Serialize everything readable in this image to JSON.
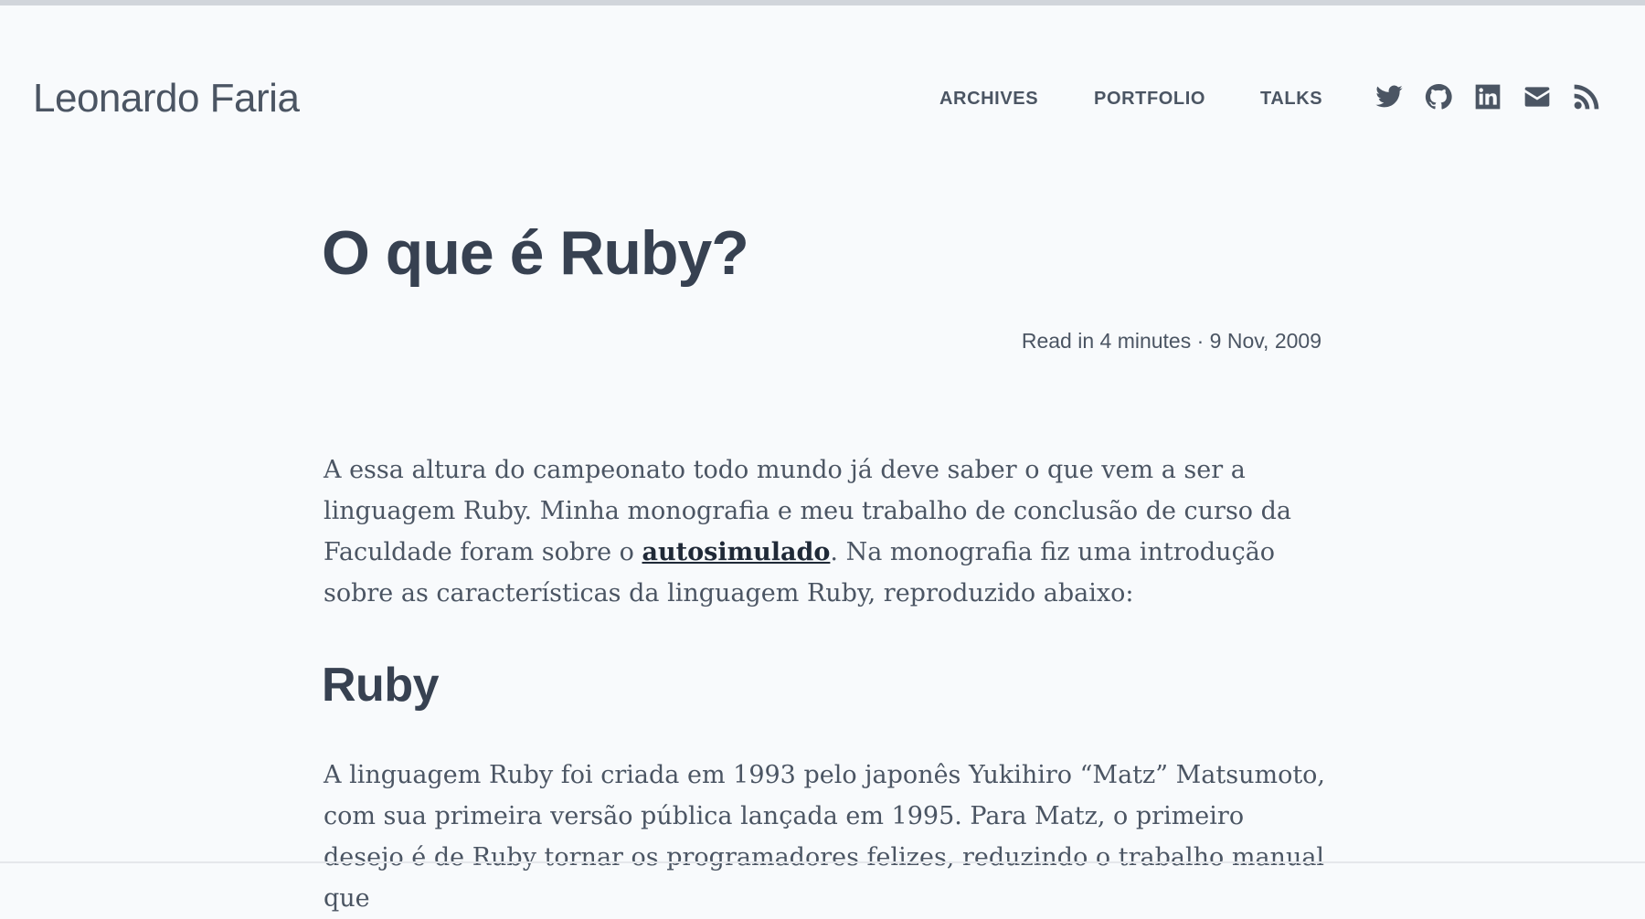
{
  "site": {
    "title": "Leonardo Faria"
  },
  "nav": {
    "items": [
      {
        "label": "ARCHIVES"
      },
      {
        "label": "PORTFOLIO"
      },
      {
        "label": "TALKS"
      }
    ],
    "social_icons": [
      "twitter-icon",
      "github-icon",
      "linkedin-icon",
      "email-icon",
      "rss-icon"
    ]
  },
  "post": {
    "title": "O que é Ruby?",
    "meta": "Read in 4 minutes · 9 Nov, 2009",
    "intro": {
      "before_link": "A essa altura do campeonato todo mundo já deve saber o que vem a ser a linguagem Ruby. Minha monografia e meu trabalho de conclusão de curso da Faculdade foram sobre o ",
      "link_text": "autosimulado",
      "after_link": ". Na monografia fiz uma introdução sobre as características da linguagem Ruby, reproduzido abaixo:"
    },
    "section_heading": "Ruby",
    "section_paragraph": "A linguagem Ruby foi criada em 1993 pelo japonês Yukihiro “Matz” Matsumoto, com sua primeira versão pública lançada em 1995. Para Matz, o primeiro desejo é de Ruby tornar os programadores felizes, reduzindo o trabalho manual que"
  },
  "colors": {
    "background": "#f8fafc",
    "text": "#374151",
    "muted": "#4b5563",
    "link": "#1f2937",
    "top_bar": "#d1d5db"
  }
}
